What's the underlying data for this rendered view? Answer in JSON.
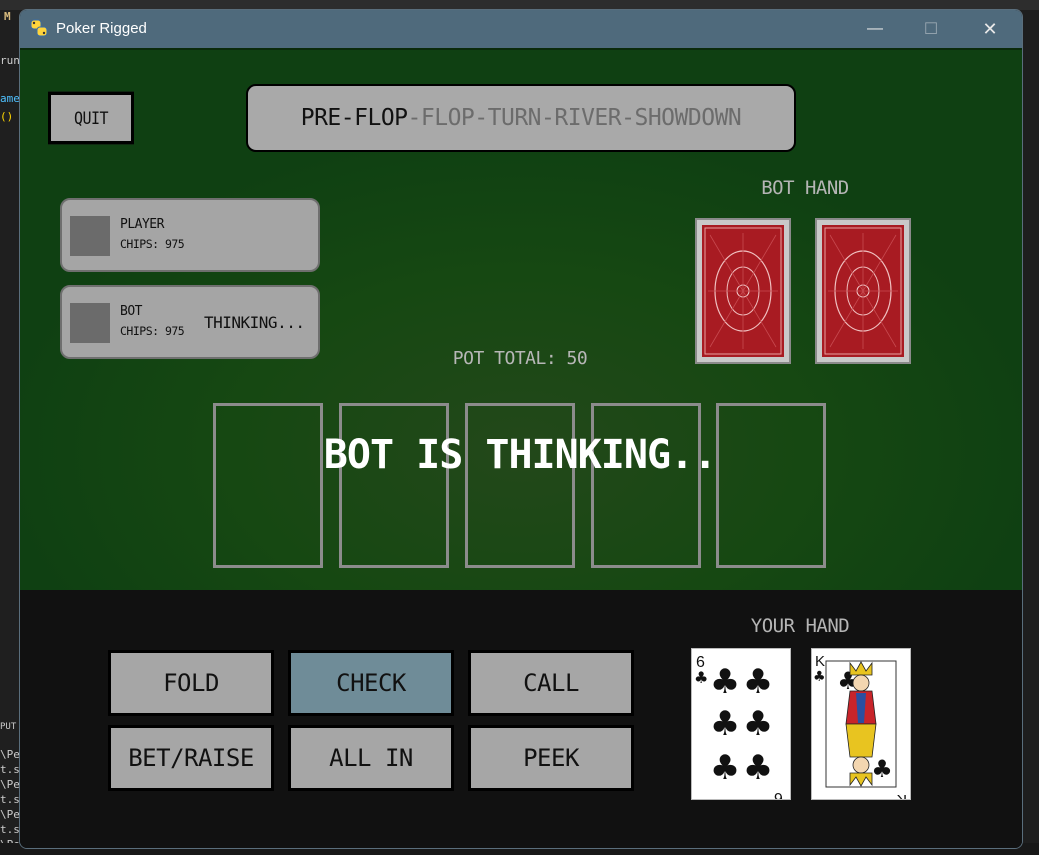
{
  "background_ide": {
    "tab_letter": "M",
    "left_snippets": [
      "run",
      "ame",
      "()",
      "PUT",
      "\\Pe",
      "t.su",
      "\\Pe",
      "t.su",
      "\\Pe",
      "t.su",
      "\\Pe",
      "t.su"
    ]
  },
  "window": {
    "title": "Poker Rigged",
    "minimize_glyph": "—",
    "maximize_glyph": "☐",
    "close_glyph": "✕"
  },
  "table": {
    "quit_label": "QUIT",
    "stages": [
      "PRE-FLOP",
      "FLOP",
      "TURN",
      "RIVER",
      "SHOWDOWN"
    ],
    "stage_separator": "-",
    "active_stage_index": 0,
    "player_panel": {
      "name": "PLAYER",
      "chips": "CHIPS: 975"
    },
    "bot_panel": {
      "name": "BOT",
      "chips": "CHIPS: 975",
      "status": "THINKING..."
    },
    "bot_hand_label": "BOT HAND",
    "pot_total": "POT TOTAL: 50",
    "community_card_slots": 5,
    "overlay_message": "BOT IS THINKING.."
  },
  "controls": {
    "your_hand_label": "YOUR HAND",
    "buttons": [
      "FOLD",
      "CHECK",
      "CALL",
      "BET/RAISE",
      "ALL IN",
      "PEEK"
    ],
    "highlighted_button": "CHECK"
  },
  "player_cards": [
    {
      "rank": "6",
      "suit": "♣",
      "suit_name": "clubs",
      "face": false
    },
    {
      "rank": "K",
      "suit": "♣",
      "suit_name": "clubs",
      "face": true
    }
  ],
  "colors": {
    "felt": "#164812",
    "button_gray": "#a6a6a6",
    "highlight": "#6f8c98",
    "titlebar": "#4f6a7c",
    "card_back_red": "#a81b22"
  }
}
